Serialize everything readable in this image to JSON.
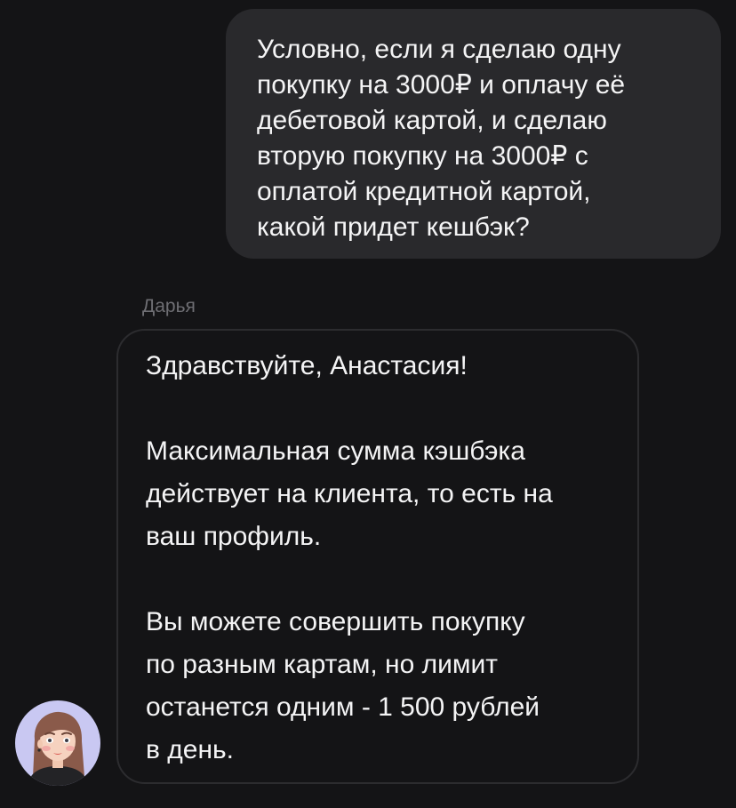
{
  "user_message": {
    "lines": [
      "Условно, если я сделаю одну",
      "покупку на 3000₽ и оплачу её",
      "дебетовой картой, и сделаю",
      "вторую покупку на 3000₽ с",
      "оплатой кредитной картой,",
      "какой придет кешбэк?"
    ]
  },
  "agent_message": {
    "sender": "Дарья",
    "lines": [
      "Здравствуйте, Анастасия!",
      "",
      "Максимальная сумма кэшбэка",
      "действует на клиента, то есть на",
      "ваш профиль.",
      "",
      "Вы можете совершить покупку",
      "по разным картам, но лимит",
      "останется одним - 1 500 рублей",
      "в день."
    ]
  },
  "colors": {
    "background": "#141416",
    "user_bubble": "#29292c",
    "agent_bubble_border": "#2c2c2f",
    "avatar_background": "#c9c8f2",
    "sender_name": "#6e6e73"
  }
}
